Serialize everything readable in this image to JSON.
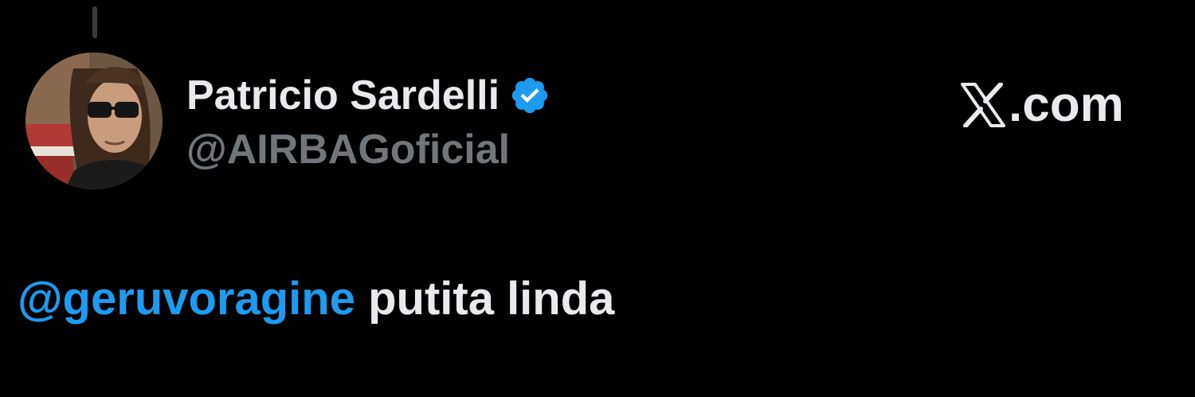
{
  "author": {
    "display_name": "Patricio Sardelli",
    "handle": "@AIRBAGoficial",
    "verified": true,
    "avatar_icon": "profile-photo",
    "badge_icon": "verified-badge-icon"
  },
  "site": {
    "logo_icon": "x-logo-icon",
    "text": ".com"
  },
  "tweet": {
    "mention": "@geruvoragine",
    "body": " putita linda"
  },
  "colors": {
    "background": "#000000",
    "primary_text": "#e9eaeb",
    "secondary_text": "#71767b",
    "accent": "#1d9bf0"
  }
}
